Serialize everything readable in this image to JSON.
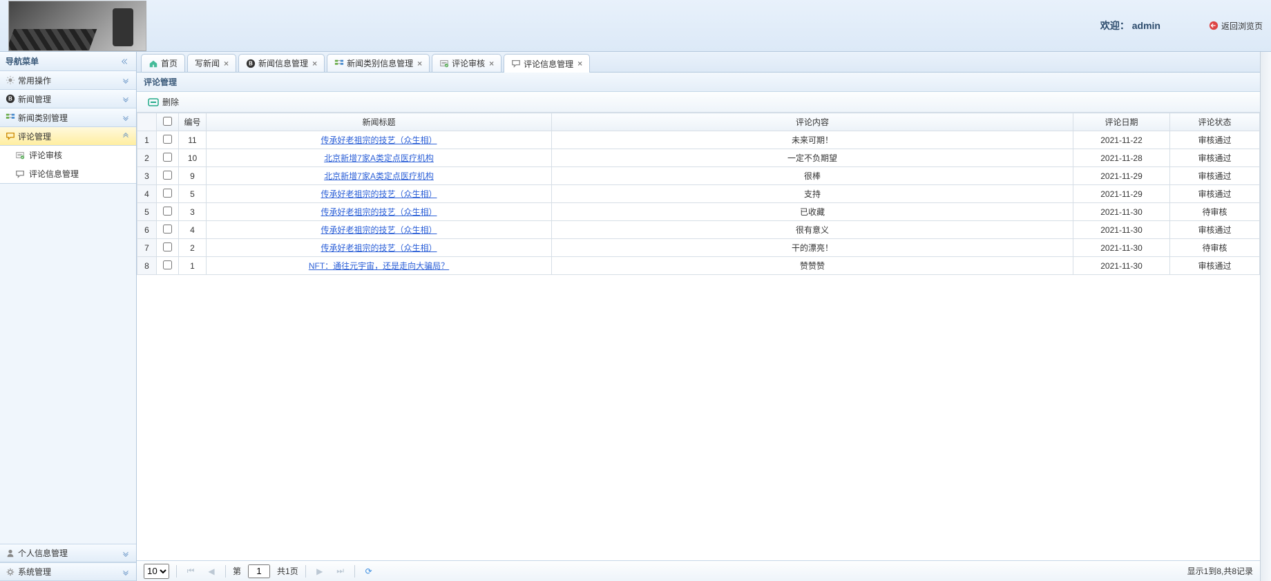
{
  "header": {
    "welcome_prefix": "欢迎：",
    "username": "admin",
    "back_link": "返回浏览页"
  },
  "sidebar": {
    "title": "导航菜单",
    "sections": [
      {
        "label": "常用操作",
        "icon": "gear"
      },
      {
        "label": "新闻管理",
        "icon": "blog"
      },
      {
        "label": "新闻类别管理",
        "icon": "tree"
      },
      {
        "label": "评论管理",
        "icon": "chat",
        "active": true,
        "items": [
          {
            "label": "评论审核",
            "icon": "review"
          },
          {
            "label": "评论信息管理",
            "icon": "chat-o"
          }
        ]
      }
    ],
    "bottom": [
      {
        "label": "个人信息管理",
        "icon": "user"
      },
      {
        "label": "系统管理",
        "icon": "cog"
      }
    ]
  },
  "tabs": [
    {
      "label": "首页",
      "icon": "home",
      "closable": false
    },
    {
      "label": "写新闻",
      "closable": true
    },
    {
      "label": "新闻信息管理",
      "icon": "blog",
      "closable": true
    },
    {
      "label": "新闻类别信息管理",
      "icon": "tree",
      "closable": true
    },
    {
      "label": "评论审核",
      "icon": "review",
      "closable": true
    },
    {
      "label": "评论信息管理",
      "icon": "chat-o",
      "closable": true,
      "active": true
    }
  ],
  "panel": {
    "title": "评论管理",
    "delete_btn": "删除"
  },
  "table": {
    "columns": [
      "编号",
      "新闻标题",
      "评论内容",
      "评论日期",
      "评论状态"
    ],
    "rows": [
      {
        "no": "11",
        "title": "传承好老祖宗的技艺（众生相）",
        "content": "未来可期！",
        "date": "2021-11-22",
        "status": "审核通过"
      },
      {
        "no": "10",
        "title": "北京新增7家A类定点医疗机构",
        "content": "一定不负期望",
        "date": "2021-11-28",
        "status": "审核通过"
      },
      {
        "no": "9",
        "title": "北京新增7家A类定点医疗机构",
        "content": "很棒",
        "date": "2021-11-29",
        "status": "审核通过"
      },
      {
        "no": "5",
        "title": "传承好老祖宗的技艺（众生相）",
        "content": "支持",
        "date": "2021-11-29",
        "status": "审核通过"
      },
      {
        "no": "3",
        "title": "传承好老祖宗的技艺（众生相）",
        "content": "已收藏",
        "date": "2021-11-30",
        "status": "待审核"
      },
      {
        "no": "4",
        "title": "传承好老祖宗的技艺（众生相）",
        "content": "很有意义",
        "date": "2021-11-30",
        "status": "审核通过"
      },
      {
        "no": "2",
        "title": "传承好老祖宗的技艺（众生相）",
        "content": "干的漂亮！",
        "date": "2021-11-30",
        "status": "待审核"
      },
      {
        "no": "1",
        "title": "NFT：通往元宇宙，还是走向大骗局？",
        "content": "赞赞赞",
        "date": "2021-11-30",
        "status": "审核通过"
      }
    ]
  },
  "pager": {
    "page_size": "10",
    "page_label_prefix": "第",
    "page_value": "1",
    "page_total": "共1页",
    "info": "显示1到8,共8记录"
  }
}
